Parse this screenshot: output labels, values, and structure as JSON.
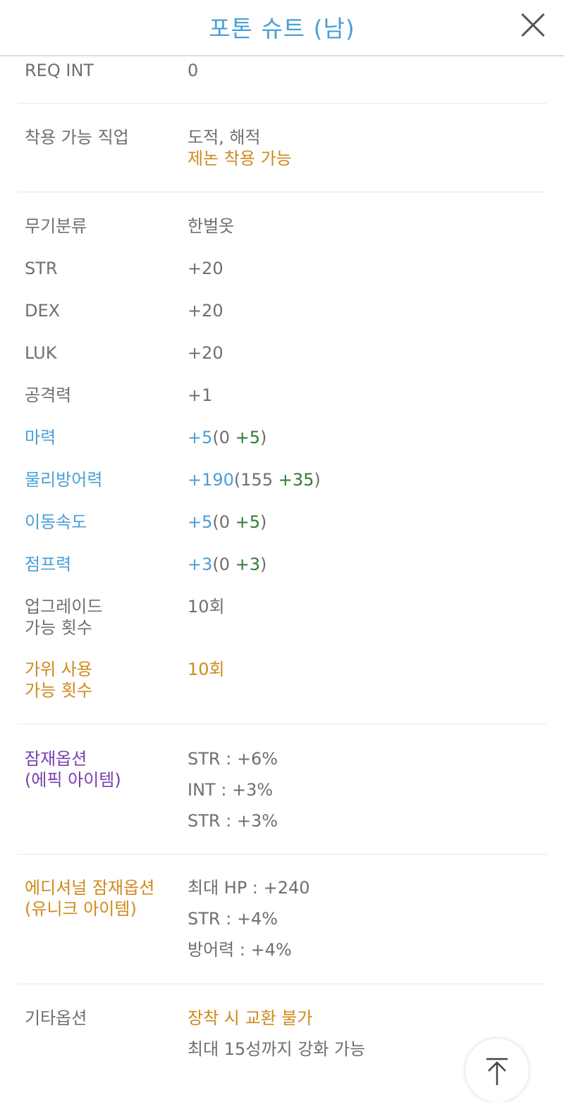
{
  "header": {
    "title": "포톤 슈트 (남)"
  },
  "req_int": {
    "label": "REQ INT",
    "value": "0"
  },
  "jobs": {
    "label": "착용 가능 직업",
    "value": "도적, 해적",
    "note": "제논 착용 가능"
  },
  "weapon_class": {
    "label": "무기분류",
    "value": "한벌옷"
  },
  "str": {
    "label": "STR",
    "value": "+20"
  },
  "dex": {
    "label": "DEX",
    "value": "+20"
  },
  "luk": {
    "label": "LUK",
    "value": "+20"
  },
  "attack": {
    "label": "공격력",
    "value": "+1"
  },
  "magic": {
    "label": "마력",
    "total": "+5",
    "open": "(0 ",
    "bonus": "+5",
    "close": ")"
  },
  "pdef": {
    "label": "물리방어력",
    "total": "+190",
    "open": "(155 ",
    "bonus": "+35",
    "close": ")"
  },
  "speed": {
    "label": "이동속도",
    "total": "+5",
    "open": "(0 ",
    "bonus": "+5",
    "close": ")"
  },
  "jump": {
    "label": "점프력",
    "total": "+3",
    "open": "(0 ",
    "bonus": "+3",
    "close": ")"
  },
  "upgrades": {
    "label_1": "업그레이드",
    "label_2": "가능 횟수",
    "value": "10회"
  },
  "scissors": {
    "label_1": "가위 사용",
    "label_2": "가능 횟수",
    "value": "10회"
  },
  "potential": {
    "label_1": "잠재옵션",
    "label_2": "(에픽 아이템)",
    "lines": [
      "STR : +6%",
      "INT : +3%",
      "STR : +3%"
    ]
  },
  "additional": {
    "label_1": "에디셔널 잠재옵션",
    "label_2": "(유니크 아이템)",
    "lines": [
      "최대 HP : +240",
      "STR : +4%",
      "방어력 : +4%"
    ]
  },
  "etc": {
    "label": "기타옵션",
    "line_1": "장착 시 교환 불가",
    "line_2": "최대 15성까지 강화 가능"
  },
  "icons": {
    "close": "close-icon",
    "scroll_top": "arrow-up-icon"
  }
}
